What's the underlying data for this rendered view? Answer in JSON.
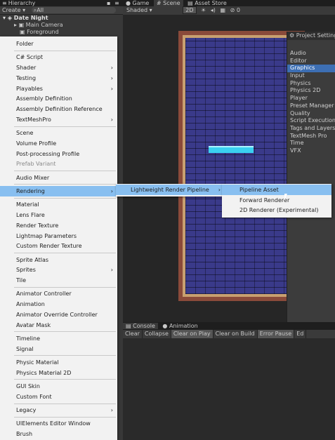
{
  "hierarchy": {
    "tab_label": "Hierarchy",
    "create_label": "Create",
    "search_label": "All",
    "scene_name": "Date Night",
    "children": [
      "Main Camera",
      "Foreground"
    ]
  },
  "scene_view": {
    "tabs": [
      "Game",
      "Scene",
      "Asset Store"
    ],
    "shading_mode": "Shaded",
    "mode_2d": "2D",
    "gizmo_count": "0"
  },
  "project_settings": {
    "title": "Project Settings",
    "items": [
      "Audio",
      "Editor",
      "Graphics",
      "Input",
      "Physics",
      "Physics 2D",
      "Player",
      "Preset Manager",
      "Quality",
      "Script Execution",
      "Tags and Layers",
      "TextMesh Pro",
      "Time",
      "VFX"
    ],
    "selected": "Graphics"
  },
  "console": {
    "tabs": [
      "Console",
      "Animation"
    ],
    "buttons": [
      "Clear",
      "Collapse",
      "Clear on Play",
      "Clear on Build",
      "Error Pause",
      "Ed"
    ]
  },
  "menu": {
    "items": [
      {
        "label": "Folder"
      },
      {
        "sep": true
      },
      {
        "label": "C# Script"
      },
      {
        "label": "Shader",
        "submenu": true
      },
      {
        "label": "Testing",
        "submenu": true
      },
      {
        "label": "Playables",
        "submenu": true
      },
      {
        "label": "Assembly Definition"
      },
      {
        "label": "Assembly Definition Reference"
      },
      {
        "label": "TextMeshPro",
        "submenu": true
      },
      {
        "sep": true
      },
      {
        "label": "Scene"
      },
      {
        "label": "Volume Profile"
      },
      {
        "label": "Post-processing Profile"
      },
      {
        "label": "Prefab Variant",
        "disabled": true
      },
      {
        "sep": true
      },
      {
        "label": "Audio Mixer"
      },
      {
        "sep": true
      },
      {
        "label": "Rendering",
        "submenu": true,
        "highlighted": true
      },
      {
        "sep": true
      },
      {
        "label": "Material"
      },
      {
        "label": "Lens Flare"
      },
      {
        "label": "Render Texture"
      },
      {
        "label": "Lightmap Parameters"
      },
      {
        "label": "Custom Render Texture"
      },
      {
        "sep": true
      },
      {
        "label": "Sprite Atlas"
      },
      {
        "label": "Sprites",
        "submenu": true
      },
      {
        "label": "Tile"
      },
      {
        "sep": true
      },
      {
        "label": "Animator Controller"
      },
      {
        "label": "Animation"
      },
      {
        "label": "Animator Override Controller"
      },
      {
        "label": "Avatar Mask"
      },
      {
        "sep": true
      },
      {
        "label": "Timeline"
      },
      {
        "label": "Signal"
      },
      {
        "sep": true
      },
      {
        "label": "Physic Material"
      },
      {
        "label": "Physics Material 2D"
      },
      {
        "sep": true
      },
      {
        "label": "GUI Skin"
      },
      {
        "label": "Custom Font"
      },
      {
        "sep": true
      },
      {
        "label": "Legacy",
        "submenu": true
      },
      {
        "sep": true
      },
      {
        "label": "UIElements Editor Window"
      },
      {
        "label": "Brush"
      }
    ]
  },
  "rendering_submenu": {
    "label": "Lightweight Render Pipeline"
  },
  "lwrp_submenu": {
    "items": [
      "Pipeline Asset",
      "Forward Renderer",
      "2D Renderer (Experimental)"
    ],
    "highlighted": "Pipeline Asset"
  }
}
